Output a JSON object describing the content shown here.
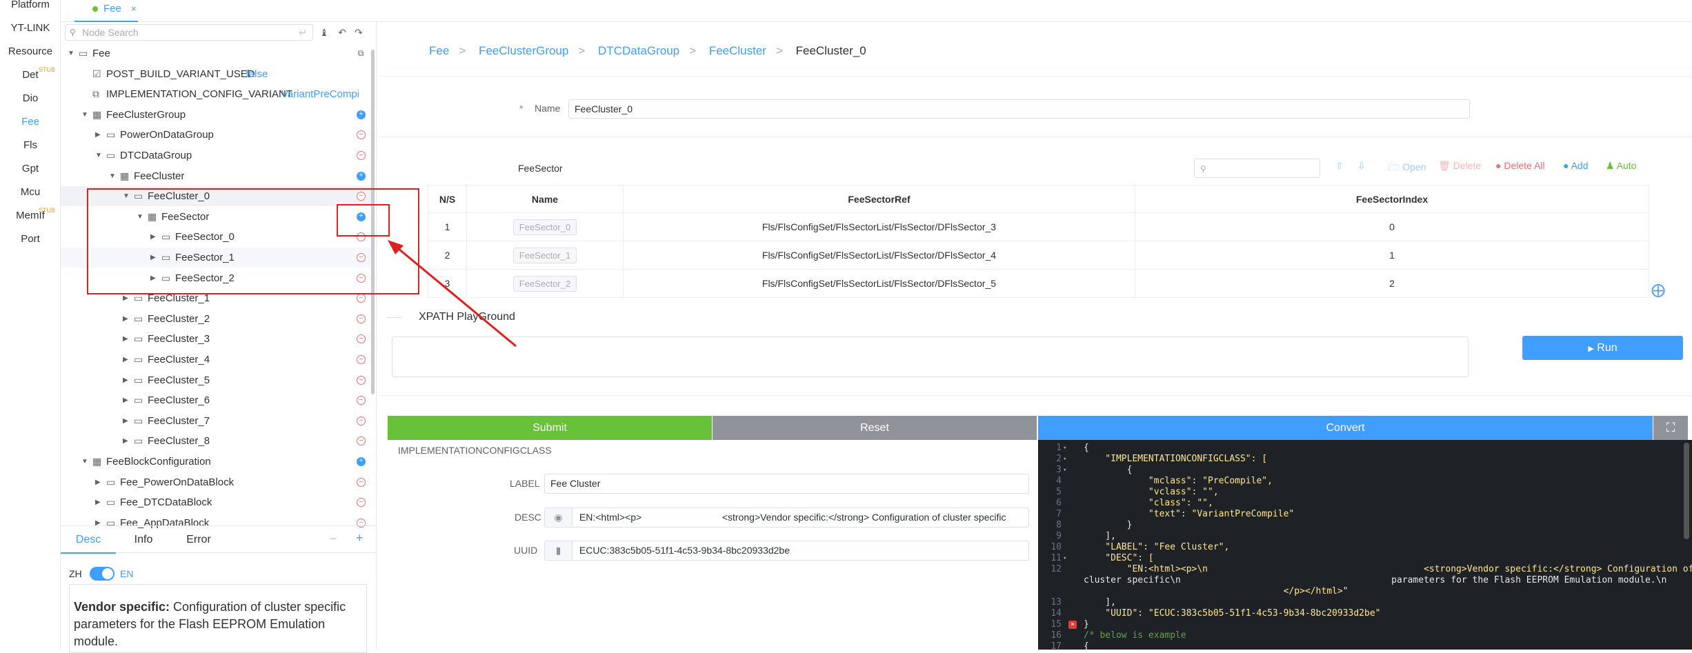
{
  "leftnav": {
    "items": [
      {
        "label": "Platform",
        "stub": false
      },
      {
        "label": "YT-LINK",
        "stub": false
      },
      {
        "label": "Resource",
        "stub": false
      },
      {
        "label": "Det",
        "stub": true
      },
      {
        "label": "Dio",
        "stub": false
      },
      {
        "label": "Fee",
        "stub": false
      },
      {
        "label": "Fls",
        "stub": false
      },
      {
        "label": "Gpt",
        "stub": false
      },
      {
        "label": "Mcu",
        "stub": false
      },
      {
        "label": "MemIf",
        "stub": true
      },
      {
        "label": "Port",
        "stub": false
      }
    ],
    "stub_label": "STUB",
    "active": "Fee"
  },
  "tabbar": {
    "tab_label": "Fee",
    "close": "×"
  },
  "tree": {
    "search_placeholder": "Node Search",
    "rows": [
      {
        "label": "Fee",
        "type": "folder"
      },
      {
        "label": "POST_BUILD_VARIANT_USED",
        "value": "false",
        "type": "check"
      },
      {
        "label": "IMPLEMENTATION_CONFIG_VARIANT",
        "value": "VariantPreCompi",
        "type": "param"
      },
      {
        "label": "FeeClusterGroup",
        "type": "table",
        "op": "add"
      },
      {
        "label": "PowerOnDataGroup",
        "type": "folder",
        "op": "remove"
      },
      {
        "label": "DTCDataGroup",
        "type": "folder",
        "op": "remove"
      },
      {
        "label": "FeeCluster",
        "type": "table",
        "op": "add"
      },
      {
        "label": "FeeCluster_0",
        "type": "folder",
        "op": "remove"
      },
      {
        "label": "FeeSector",
        "type": "table",
        "op": "add"
      },
      {
        "label": "FeeSector_0",
        "type": "folder",
        "op": "remove"
      },
      {
        "label": "FeeSector_1",
        "type": "folder",
        "op": "remove"
      },
      {
        "label": "FeeSector_2",
        "type": "folder",
        "op": "remove"
      },
      {
        "label": "FeeCluster_1",
        "type": "folder",
        "op": "remove"
      },
      {
        "label": "FeeCluster_2",
        "type": "folder",
        "op": "remove"
      },
      {
        "label": "FeeCluster_3",
        "type": "folder",
        "op": "remove"
      },
      {
        "label": "FeeCluster_4",
        "type": "folder",
        "op": "remove"
      },
      {
        "label": "FeeCluster_5",
        "type": "folder",
        "op": "remove"
      },
      {
        "label": "FeeCluster_6",
        "type": "folder",
        "op": "remove"
      },
      {
        "label": "FeeCluster_7",
        "type": "folder",
        "op": "remove"
      },
      {
        "label": "FeeCluster_8",
        "type": "folder",
        "op": "remove"
      },
      {
        "label": "FeeBlockConfiguration",
        "type": "table",
        "op": "add"
      },
      {
        "label": "Fee_PowerOnDataBlock",
        "type": "folder",
        "op": "remove"
      },
      {
        "label": "Fee_DTCDataBlock",
        "type": "folder",
        "op": "remove"
      },
      {
        "label": "Fee_AppDataBlock",
        "type": "folder",
        "op": "remove"
      }
    ]
  },
  "info": {
    "tabs": [
      "Desc",
      "Info",
      "Error"
    ],
    "lang_left": "ZH",
    "lang_right": "EN",
    "desc_bold": "Vendor specific:",
    "desc_text": " Configuration of cluster specific parameters for the Flash EEPROM Emulation module."
  },
  "breadcrumb": [
    "Fee",
    "FeeClusterGroup",
    "DTCDataGroup",
    "FeeCluster",
    "FeeCluster_0"
  ],
  "form": {
    "required": "*",
    "name_label": "Name",
    "name_value": "FeeCluster_0"
  },
  "table": {
    "title": "FeeSector",
    "actions": {
      "open": "Open",
      "delete": "Delete",
      "delete_all": "Delete All",
      "add": "Add",
      "auto": "Auto"
    },
    "headers": [
      "N/S",
      "Name",
      "FeeSectorRef",
      "FeeSectorIndex"
    ],
    "rows": [
      {
        "ns": "1",
        "name": "FeeSector_0",
        "ref": "Fls/FlsConfigSet/FlsSectorList/FlsSector/DFlsSector_3",
        "index": "0"
      },
      {
        "ns": "2",
        "name": "FeeSector_1",
        "ref": "Fls/FlsConfigSet/FlsSectorList/FlsSector/DFlsSector_4",
        "index": "1"
      },
      {
        "ns": "3",
        "name": "FeeSector_2",
        "ref": "Fls/FlsConfigSet/FlsSectorList/FlsSector/DFlsSector_5",
        "index": "2"
      }
    ]
  },
  "xpath": {
    "title": "XPATH PlayGround",
    "run": "Run"
  },
  "buttons": {
    "submit": "Submit",
    "reset": "Reset",
    "convert": "Convert"
  },
  "colors": {
    "primary": "#409eff",
    "success": "#67c23a",
    "danger": "#f56c6c",
    "reset": "#909399",
    "annotation": "#e02020"
  },
  "meta": {
    "section": "IMPLEMENTATIONCONFIGCLASS",
    "label_label": "LABEL",
    "label_value": "Fee Cluster",
    "desc_label": "DESC",
    "desc_value": "EN:<html><p>                              <strong>Vendor specific:</strong> Configuration of cluster specific",
    "uuid_label": "UUID",
    "uuid_value": "ECUC:383c5b05-51f1-4c53-9b34-8bc20933d2be"
  },
  "code": {
    "lines": [
      {
        "n": "1",
        "fold": true,
        "text": "{"
      },
      {
        "n": "2",
        "fold": true,
        "text": "    \"IMPLEMENTATIONCONFIGCLASS\": ["
      },
      {
        "n": "3",
        "fold": true,
        "text": "        {"
      },
      {
        "n": "4",
        "fold": false,
        "text": "            \"mclass\": \"PreCompile\","
      },
      {
        "n": "5",
        "fold": false,
        "text": "            \"vclass\": \"\","
      },
      {
        "n": "6",
        "fold": false,
        "text": "            \"class\": \"\","
      },
      {
        "n": "7",
        "fold": false,
        "text": "            \"text\": \"VariantPreCompile\""
      },
      {
        "n": "8",
        "fold": false,
        "text": "        }"
      },
      {
        "n": "9",
        "fold": false,
        "text": "    ],"
      },
      {
        "n": "10",
        "fold": false,
        "text": "    \"LABEL\": \"Fee Cluster\","
      },
      {
        "n": "11",
        "fold": true,
        "text": "    \"DESC\": ["
      },
      {
        "n": "12",
        "fold": false,
        "text": "        \"EN:<html><p>\\n                                        <strong>Vendor specific:</strong> Configuration of"
      },
      {
        "n": "",
        "fold": false,
        "text": "cluster specific\\n                                       parameters for the Flash EEPROM Emulation module.\\n"
      },
      {
        "n": "",
        "fold": false,
        "text": "                                     </p></html>\""
      },
      {
        "n": "13",
        "fold": false,
        "text": "    ],"
      },
      {
        "n": "14",
        "fold": false,
        "text": "    \"UUID\": \"ECUC:383c5b05-51f1-4c53-9b34-8bc20933d2be\""
      },
      {
        "n": "15",
        "fold": false,
        "text": "}"
      },
      {
        "n": "16",
        "fold": false,
        "text": "/* below is example"
      },
      {
        "n": "17",
        "fold": false,
        "text": "{"
      }
    ]
  }
}
